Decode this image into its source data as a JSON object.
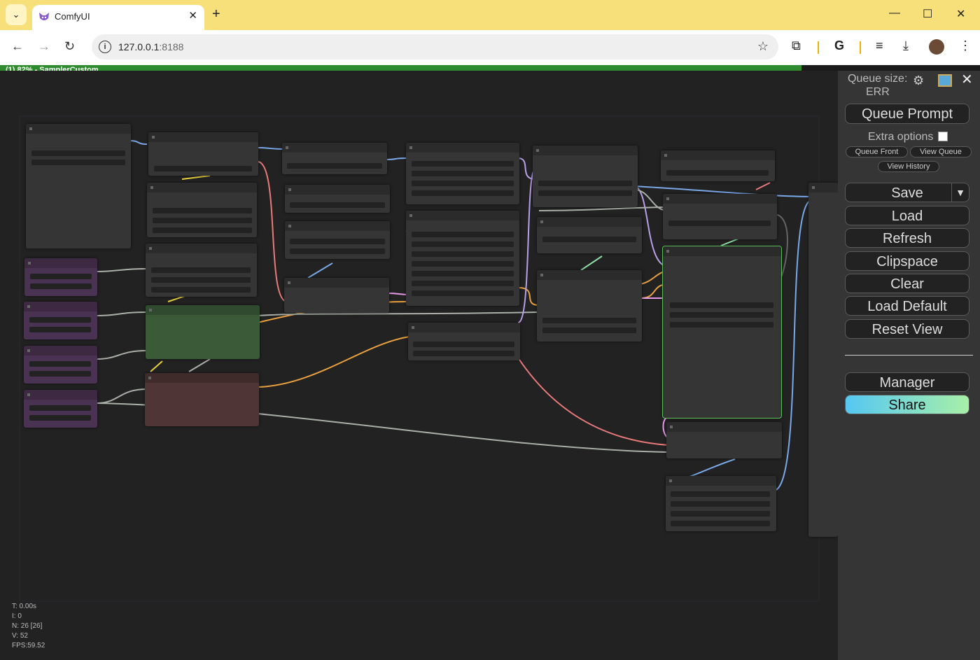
{
  "browser": {
    "tab_title": "ComfyUI",
    "url_host": "127.0.0.1",
    "url_port": ":8188",
    "tab_close": "✕",
    "new_tab": "+",
    "minimize": "—",
    "maximize": "☐",
    "close": "✕"
  },
  "progress": {
    "text": "(1) 82% - SamplerCustom",
    "percent": 82
  },
  "stats": {
    "t": "T: 0.00s",
    "i": "I: 0",
    "n": "N: 26 [26]",
    "v": "V: 52",
    "fps": "FPS:59.52"
  },
  "menu": {
    "queue_size_label": "Queue size:",
    "queue_size_value": "ERR",
    "queue_prompt": "Queue Prompt",
    "extra_options": "Extra options",
    "queue_front": "Queue Front",
    "view_queue": "View Queue",
    "view_history": "View History",
    "save": "Save",
    "load": "Load",
    "refresh": "Refresh",
    "clipspace": "Clipspace",
    "clear": "Clear",
    "load_default": "Load Default",
    "reset_view": "Reset View",
    "manager": "Manager",
    "share": "Share"
  },
  "colors": {
    "tabbar": "#f7df7a",
    "progress": "#2e8b2e",
    "canvas": "#222222",
    "node": "#353535",
    "node_green": "#3a5a38",
    "node_red": "#4f3535",
    "node_purple": "#3d2a42",
    "link_blue": "#7aa8e8",
    "link_orange": "#e8a040",
    "link_pink": "#e87a7a",
    "link_grey": "#aab0a8",
    "link_lilac": "#b8a0e8",
    "link_yellow": "#e8d040"
  }
}
